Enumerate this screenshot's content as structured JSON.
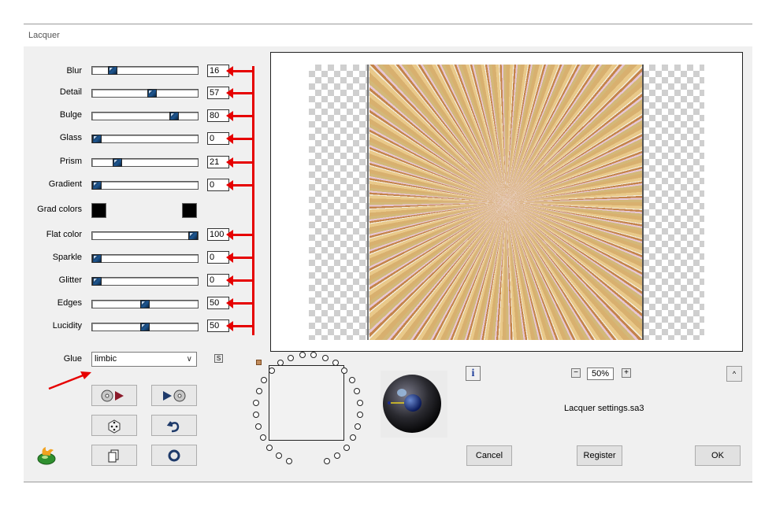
{
  "window": {
    "title": "Lacquer"
  },
  "params": [
    {
      "label": "Blur",
      "value": "16",
      "fraction": 0.16
    },
    {
      "label": "Detail",
      "value": "57",
      "fraction": 0.57
    },
    {
      "label": "Bulge",
      "value": "80",
      "fraction": 0.8
    },
    {
      "label": "Glass",
      "value": "0",
      "fraction": 0.0
    },
    {
      "label": "Prism",
      "value": "21",
      "fraction": 0.21
    },
    {
      "label": "Gradient",
      "value": "0",
      "fraction": 0.0
    },
    {
      "label": "Flat color",
      "value": "100",
      "fraction": 1.0
    },
    {
      "label": "Sparkle",
      "value": "0",
      "fraction": 0.0
    },
    {
      "label": "Glitter",
      "value": "0",
      "fraction": 0.0
    },
    {
      "label": "Edges",
      "value": "50",
      "fraction": 0.5
    },
    {
      "label": "Lucidity",
      "value": "50",
      "fraction": 0.5
    }
  ],
  "grad_colors": {
    "label": "Grad colors",
    "color1": "#000000",
    "color2": "#000000"
  },
  "glue": {
    "label": "Glue",
    "value": "limbic",
    "s_label": "S"
  },
  "zoom": {
    "value": "50%"
  },
  "settings_file": "Lacquer settings.sa3",
  "buttons": {
    "cancel": "Cancel",
    "register": "Register",
    "ok": "OK"
  },
  "colors": {
    "annotation": "#e60000",
    "thumb": "#1e5690",
    "dialog_bg": "#f0f0f0"
  }
}
